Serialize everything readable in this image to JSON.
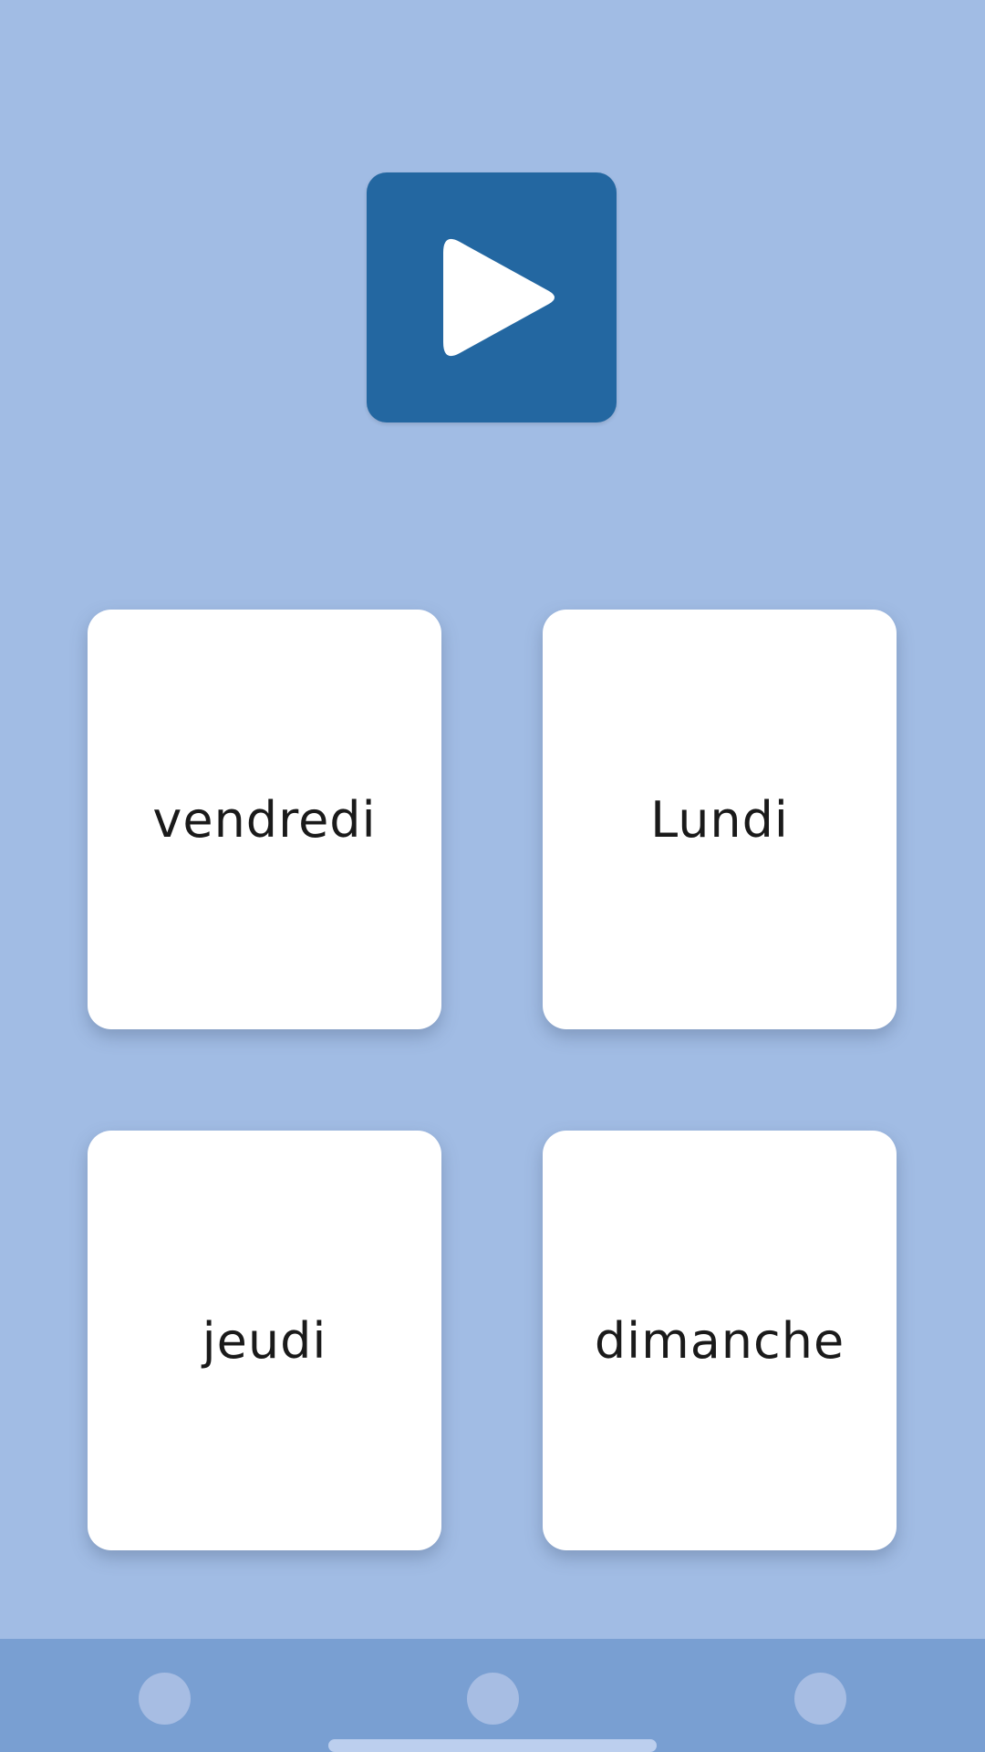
{
  "colors": {
    "background": "#a1bce4",
    "play_button": "#2367a1",
    "card": "#ffffff",
    "nav_bar": "#799fd2",
    "nav_dot": "#a7bde3"
  },
  "play": {
    "icon": "play-icon"
  },
  "cards": [
    {
      "label": "vendredi"
    },
    {
      "label": "Lundi"
    },
    {
      "label": "jeudi"
    },
    {
      "label": "dimanche"
    }
  ],
  "nav": {
    "buttons": [
      "circle-dot-icon",
      "circle-dot-icon",
      "circle-dot-icon"
    ]
  }
}
